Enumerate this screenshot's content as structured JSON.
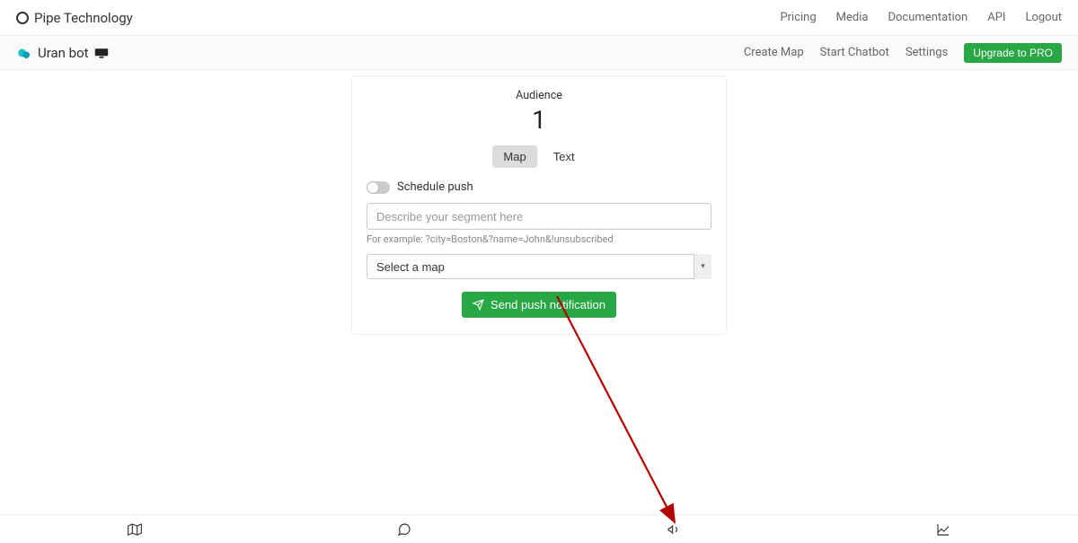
{
  "header": {
    "brand": "Pipe Technology",
    "nav": {
      "pricing": "Pricing",
      "media": "Media",
      "docs": "Documentation",
      "api": "API",
      "logout": "Logout"
    }
  },
  "subheader": {
    "bot_name": "Uran bot",
    "actions": {
      "create_map": "Create Map",
      "start_chatbot": "Start Chatbot",
      "settings": "Settings",
      "upgrade": "Upgrade to PRO"
    }
  },
  "panel": {
    "audience_label": "Audience",
    "audience_count": "1",
    "tabs": {
      "map": "Map",
      "text": "Text"
    },
    "schedule_label": "Schedule push",
    "segment_placeholder": "Describe your segment here",
    "example_hint": "For example: ?city=Boston&?name=John&!unsubscribed",
    "select_placeholder": "Select a map",
    "send_button": "Send push notification"
  },
  "footer": {
    "map": "map-icon",
    "chat": "chat-icon",
    "megaphone": "megaphone-icon",
    "chart": "chart-icon"
  }
}
